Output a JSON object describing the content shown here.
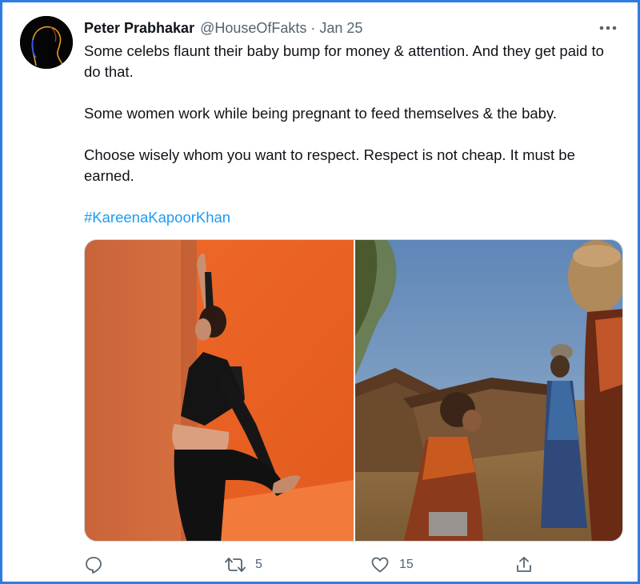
{
  "tweet": {
    "author_name": "Peter Prabhakar",
    "handle": "@HouseOfFakts",
    "separator": "·",
    "date": "Jan 25",
    "paragraphs": [
      "Some celebs flaunt their baby bump for money & attention. And they get paid to do that.",
      "Some women work while being pregnant to feed themselves & the baby.",
      "Choose wisely whom you want to respect. Respect is not cheap. It must be earned."
    ],
    "hashtag": "#KareenaKapoorKhan"
  },
  "actions": {
    "reply_icon": "reply-icon",
    "retweet_icon": "retweet-icon",
    "retweet_count": "5",
    "like_icon": "heart-icon",
    "like_count": "15",
    "share_icon": "share-icon"
  },
  "colors": {
    "frame_border": "#2e7ce0",
    "link": "#1d9bf0",
    "secondary_text": "#536471"
  }
}
